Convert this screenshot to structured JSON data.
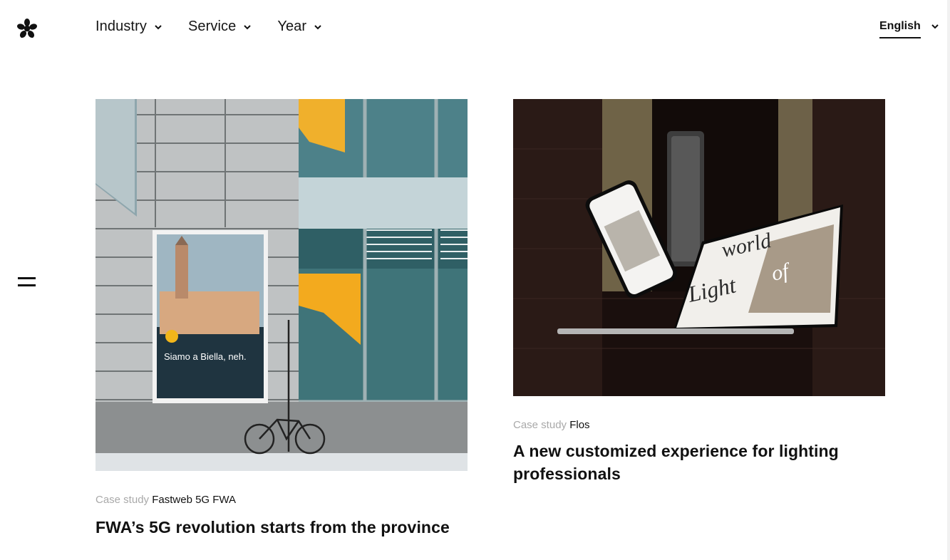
{
  "header": {
    "logo_icon": "asterisk-flower-icon",
    "nav": [
      {
        "label": "Industry",
        "icon": "chevron-down-icon"
      },
      {
        "label": "Service",
        "icon": "chevron-down-icon"
      },
      {
        "label": "Year",
        "icon": "chevron-down-icon"
      }
    ],
    "language": {
      "label": "English",
      "icon": "chevron-down-icon"
    }
  },
  "sidebar": {
    "menu_icon": "hamburger-menu-icon"
  },
  "cards": [
    {
      "kicker": "Case study",
      "client": "Fastweb 5G FWA",
      "title": "FWA’s 5G revolution starts from the province",
      "poster_text": "Siamo a Biella, neh."
    },
    {
      "kicker": "Case study",
      "client": "Flos",
      "title": "A new customized experience for lighting professionals",
      "screen_text_1": "world",
      "screen_text_2": "of",
      "screen_text_3": "Light"
    }
  ],
  "colors": {
    "accent_text": "#111111",
    "muted_text": "#a9a9a9",
    "background": "#ffffff"
  }
}
